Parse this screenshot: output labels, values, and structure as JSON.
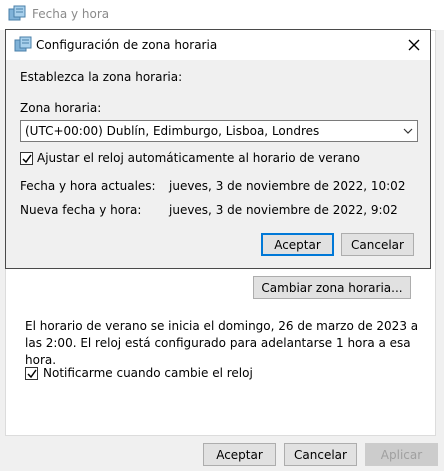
{
  "outer_window": {
    "title": "Fecha y hora",
    "change_tz_button": "Cambiar zona horaria...",
    "dst_info": "El horario de verano se inicia el domingo, 26 de marzo de 2023 a las 2:00. El reloj está configurado para adelantarse 1 hora a esa hora.",
    "notify_label": "Notificarme cuando cambie el reloj",
    "notify_checked": true,
    "ok_button": "Aceptar",
    "cancel_button": "Cancelar",
    "apply_button": "Aplicar"
  },
  "dialog": {
    "title": "Configuración de zona horaria",
    "instruction": "Establezca la zona horaria:",
    "timezone_label": "Zona horaria:",
    "timezone_value": "(UTC+00:00) Dublín, Edimburgo, Lisboa, Londres",
    "dst_checkbox_label": "Ajustar el reloj automáticamente al horario de verano",
    "dst_checked": true,
    "current_label": "Fecha y hora actuales:",
    "current_value": "jueves, 3 de noviembre de 2022, 10:02",
    "new_label": "Nueva fecha y hora:",
    "new_value": "jueves, 3 de noviembre de 2022, 9:02",
    "ok_button": "Aceptar",
    "cancel_button": "Cancelar"
  },
  "icons": {
    "window": "clock-globe-icon",
    "close": "close-icon",
    "dropdown": "chevron-down-icon",
    "check": "checkmark-icon"
  }
}
